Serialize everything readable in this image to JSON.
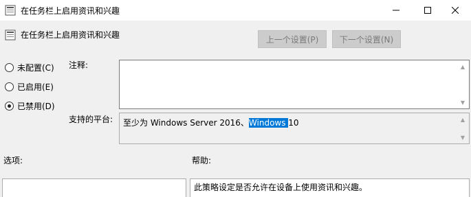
{
  "window": {
    "title": "在任务栏上启用资讯和兴趣",
    "minimize_icon": "minimize-icon",
    "maximize_icon": "maximize-icon",
    "close_icon": "close-icon"
  },
  "header": {
    "title": "在任务栏上启用资讯和兴趣",
    "prev_label": "上一个设置(P)",
    "next_label": "下一个设置(N)"
  },
  "state": {
    "options": [
      {
        "label": "未配置(C)",
        "checked": false
      },
      {
        "label": "已启用(E)",
        "checked": false
      },
      {
        "label": "已禁用(D)",
        "checked": true
      }
    ]
  },
  "comment": {
    "label": "注释:",
    "value": ""
  },
  "platform": {
    "label": "支持的平台:",
    "text_before": "至少为 Windows Server 2016、",
    "text_selected": "Windows ",
    "text_after": "10"
  },
  "options_section": {
    "label": "选项:"
  },
  "help_section": {
    "label": "帮助:",
    "text": "此策略设定是否允许在设备上使用资讯和兴趣。"
  },
  "colors": {
    "selection": "#0078d7",
    "window_bg": "#f0f0f0"
  }
}
